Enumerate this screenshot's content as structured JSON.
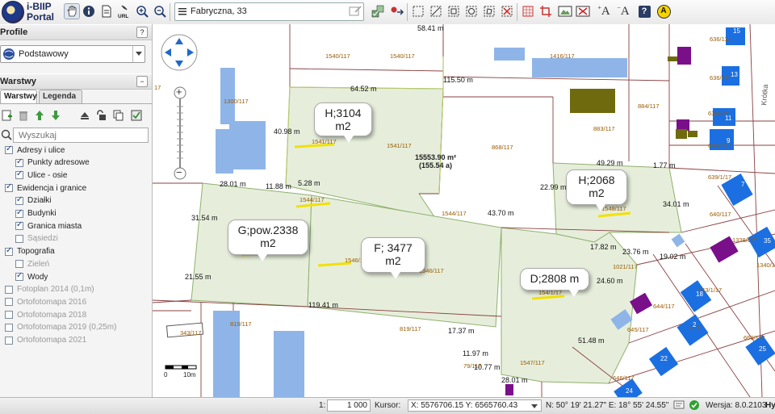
{
  "app": {
    "logo_line1": "i-BIIP",
    "logo_line2": "Portal"
  },
  "toolbar": {
    "address_value": "Fabryczna, 33",
    "icons": [
      "pan-hand-icon",
      "info-icon",
      "document-icon",
      "url-icon",
      "zoom-in-icon",
      "zoom-out-icon",
      "menu-icon",
      "layers-check-icon",
      "route-icon",
      "select-rect-icon",
      "draw-line-icon",
      "select-box-icon",
      "select-circle-icon",
      "select-poly-icon",
      "clear-selection-icon",
      "grid-icon",
      "crop-icon",
      "print-map-icon",
      "remove-layer-icon",
      "font-larger-icon",
      "font-smaller-icon",
      "help-icon",
      "accessibility-icon"
    ],
    "font_up_label": "A",
    "font_down_label": "A",
    "help_label": "?",
    "access_label": "A"
  },
  "panel": {
    "profile_title": "Profile",
    "profile_help": "?",
    "profile_value": "Podstawowy",
    "layers_title": "Warstwy",
    "tab_layers": "Warstwy",
    "tab_legend": "Legenda",
    "search_placeholder": "Wyszukaj",
    "layers": [
      {
        "label": "Adresy i ulice",
        "checked": true,
        "indent": 0
      },
      {
        "label": "Punkty adresowe",
        "checked": true,
        "indent": 1
      },
      {
        "label": "Ulice - osie",
        "checked": true,
        "indent": 1
      },
      {
        "label": "Ewidencja i granice",
        "checked": true,
        "indent": 0
      },
      {
        "label": "Działki",
        "checked": true,
        "indent": 1
      },
      {
        "label": "Budynki",
        "checked": true,
        "indent": 1
      },
      {
        "label": "Granica miasta",
        "checked": true,
        "indent": 1
      },
      {
        "label": "Sąsiedzi",
        "checked": false,
        "indent": 1
      },
      {
        "label": "Topografia",
        "checked": true,
        "indent": 0
      },
      {
        "label": "Zieleń",
        "checked": false,
        "indent": 1
      },
      {
        "label": "Wody",
        "checked": true,
        "indent": 1
      },
      {
        "label": "Fotoplan 2014 (0,1m)",
        "checked": false,
        "indent": 0
      },
      {
        "label": "Ortofotomapa 2016",
        "checked": false,
        "indent": 0
      },
      {
        "label": "Ortofotomapa 2018",
        "checked": false,
        "indent": 0
      },
      {
        "label": "Ortofotomapa 2019 (0,25m)",
        "checked": false,
        "indent": 0
      },
      {
        "label": "Ortofotomapa 2021",
        "checked": false,
        "indent": 0
      }
    ]
  },
  "map": {
    "bubbles": {
      "h1_l1": "H;3104",
      "h1_l2": "m2",
      "h2_l1": "H;2068",
      "h2_l2": "m2",
      "g_l1": "G;pow.2338",
      "g_l2": "m2",
      "f_l1": "F; 3477",
      "f_l2": "m2",
      "d_l1": "D;2808 m"
    },
    "area_main": "15553.90 m²",
    "area_sub": "(155.54 a)",
    "distances": [
      "58.41 m",
      "64.52 m",
      "115.50 m",
      "40.98 m",
      "5.28 m",
      "28.01 m",
      "11.88 m",
      "43.70 m",
      "22.99 m",
      "49.29 m",
      "1.77 m",
      "34.01 m",
      "31.54 m",
      "17.82 m",
      "23.76 m",
      "19.02 m",
      "21.55 m",
      "24.60 m",
      "119.41 m",
      "17.37 m",
      "51.48 m",
      "11.97 m",
      "10.77 m",
      "28.01 m"
    ],
    "parcels": [
      "1540/117",
      "1540/117",
      "1416/117",
      "636/117",
      "636/117",
      "1300/117",
      "884/117",
      "637/1/11",
      "883/117",
      "638/1/17",
      "1541/117",
      "1541/117",
      "868/117",
      "639/1/17",
      "1544/117",
      "1544/117",
      "1548/117",
      "640/117",
      "1338/117",
      "1546/117",
      "1546/117",
      "1021/117",
      "1340/1",
      "643/1/17",
      "644/117",
      "819/117",
      "819/117",
      "645/117",
      "343/117",
      "1547/117",
      "79/117",
      "646/117",
      "660/117",
      "154/1/17",
      "617",
      "17"
    ],
    "house_numbers": [
      "15",
      "13",
      "11",
      "9",
      "7",
      "35",
      "18",
      "2",
      "25",
      "22",
      "24"
    ],
    "street_label": "Krótka",
    "scale_zero": "0",
    "scale_len": "10m",
    "zoom_plus": "+",
    "zoom_minus": "−"
  },
  "status": {
    "scale_prefix": "1:",
    "scale_value": "1 000",
    "cursor_label": "Kursor:",
    "cursor_xy": "X: 5576706.15  Y: 6565760.43",
    "geo_coords": "N: 50° 19' 21.27\" E: 18° 55' 24.55\"",
    "version": "Wersja: 8.0.2103",
    "trailing": "Hy"
  }
}
